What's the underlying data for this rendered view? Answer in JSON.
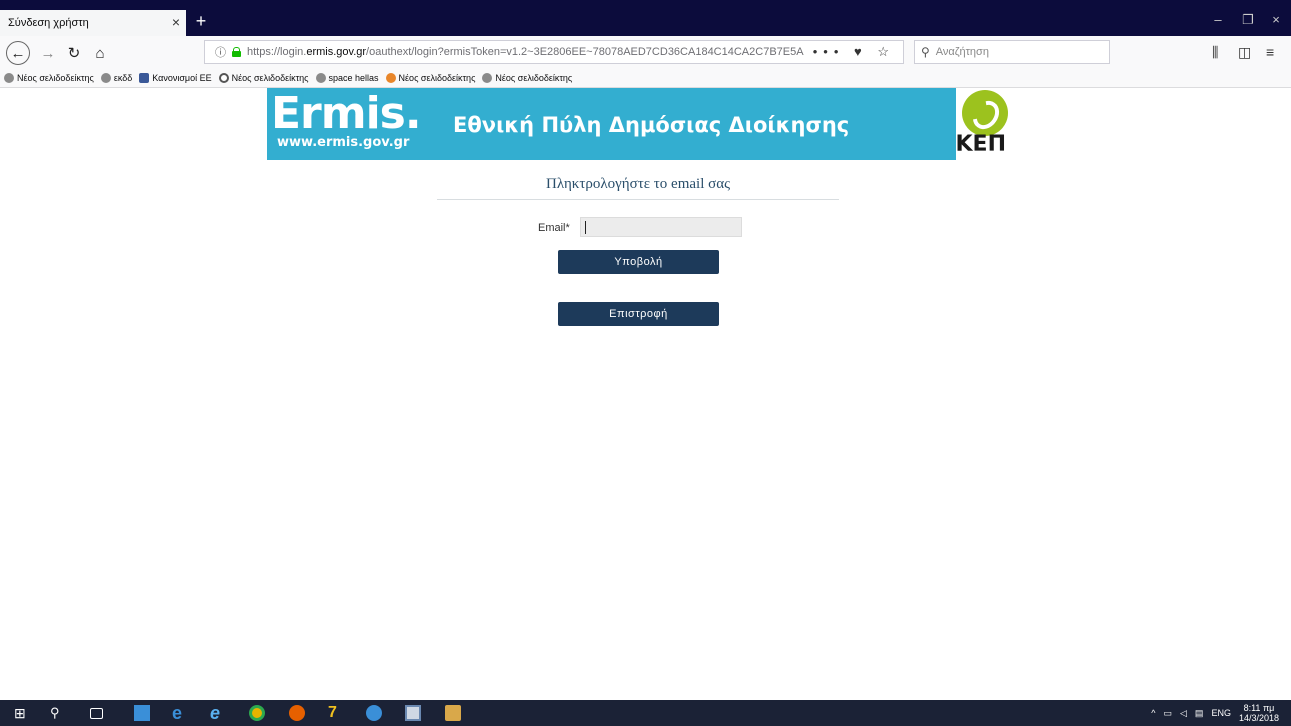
{
  "browser": {
    "tab_title": "Σύνδεση χρήστη",
    "tab_close": "×",
    "new_tab": "+",
    "window_controls": [
      "–",
      "❐",
      "×"
    ],
    "url_prefix": "https://login.",
    "url_domain": "ermis.gov.gr",
    "url_suffix": "/oauthext/login?ermisToken=v1.2~3E2806EE~78078AED7CD36CA184C14CA2C7B7E5A",
    "url_actions": "••• ♥ ☆",
    "search_placeholder": "Αναζήτηση",
    "right_icons": [
      "library-icon",
      "sidebar-icon",
      "menu-icon"
    ]
  },
  "bookmarks": [
    {
      "label": "Νέος σελιδοδείκτης",
      "color": "#8a8a8a"
    },
    {
      "label": "εκδδ",
      "color": "#8a8a8a"
    },
    {
      "label": "Κανονισμοί ΕΕ",
      "color": "#3b5998"
    },
    {
      "label": "Νέος σελιδοδείκτης",
      "color": "#555555"
    },
    {
      "label": "space hellas",
      "color": "#8a8a8a"
    },
    {
      "label": "Νέος σελιδοδείκτης",
      "color": "#e8862a"
    },
    {
      "label": "Νέος σελιδοδείκτης",
      "color": "#8a8a8a"
    }
  ],
  "banner": {
    "logo_main": "Ermis.",
    "logo_sub": "www.ermis.gov.gr",
    "title": "Εθνική Πύλη Δημόσιας Διοίκησης",
    "kep": "ΚΕΠ",
    "bg_color": "#33aed0"
  },
  "form": {
    "title": "Πληκτρολογήστε το email σας",
    "email_label": "Email*",
    "email_value": "",
    "submit_label": "Υποβολή",
    "back_label": "Επιστροφή"
  },
  "taskbar": {
    "lang": "ENG",
    "time": "8:11 πμ",
    "date": "14/3/2018"
  }
}
